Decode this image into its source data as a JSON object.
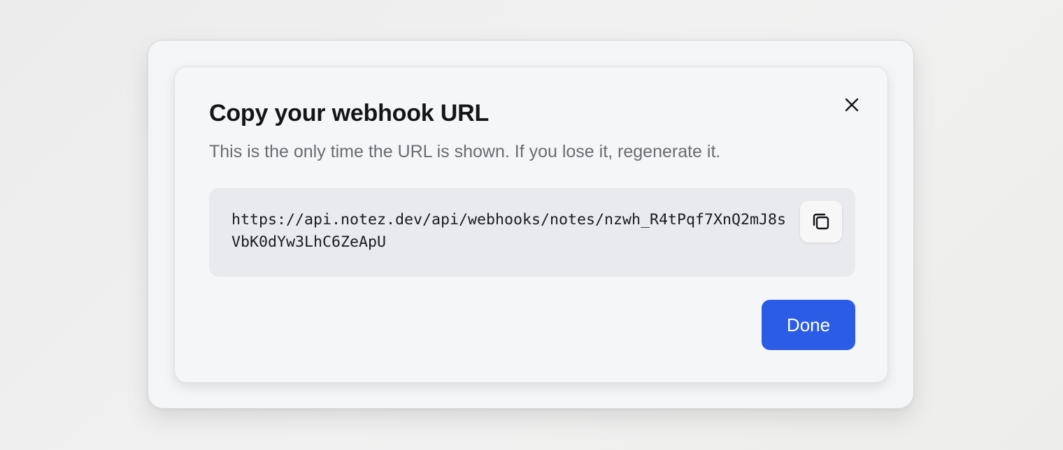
{
  "dialog": {
    "title": "Copy your webhook URL",
    "subtitle": "This is the only time the URL is shown. If you lose it, regenerate it.",
    "webhook_url": "https://api.notez.dev/api/webhooks/notes/nzwh_R4tPqf7XnQ2mJ8sVbK0dYw3LhC6ZeApU",
    "done_label": "Done",
    "close_icon": "close-icon",
    "copy_icon": "copy-icon"
  },
  "colors": {
    "accent": "#2b5ce6",
    "background": "#f5f6f8",
    "url_box": "#e9eaed"
  }
}
